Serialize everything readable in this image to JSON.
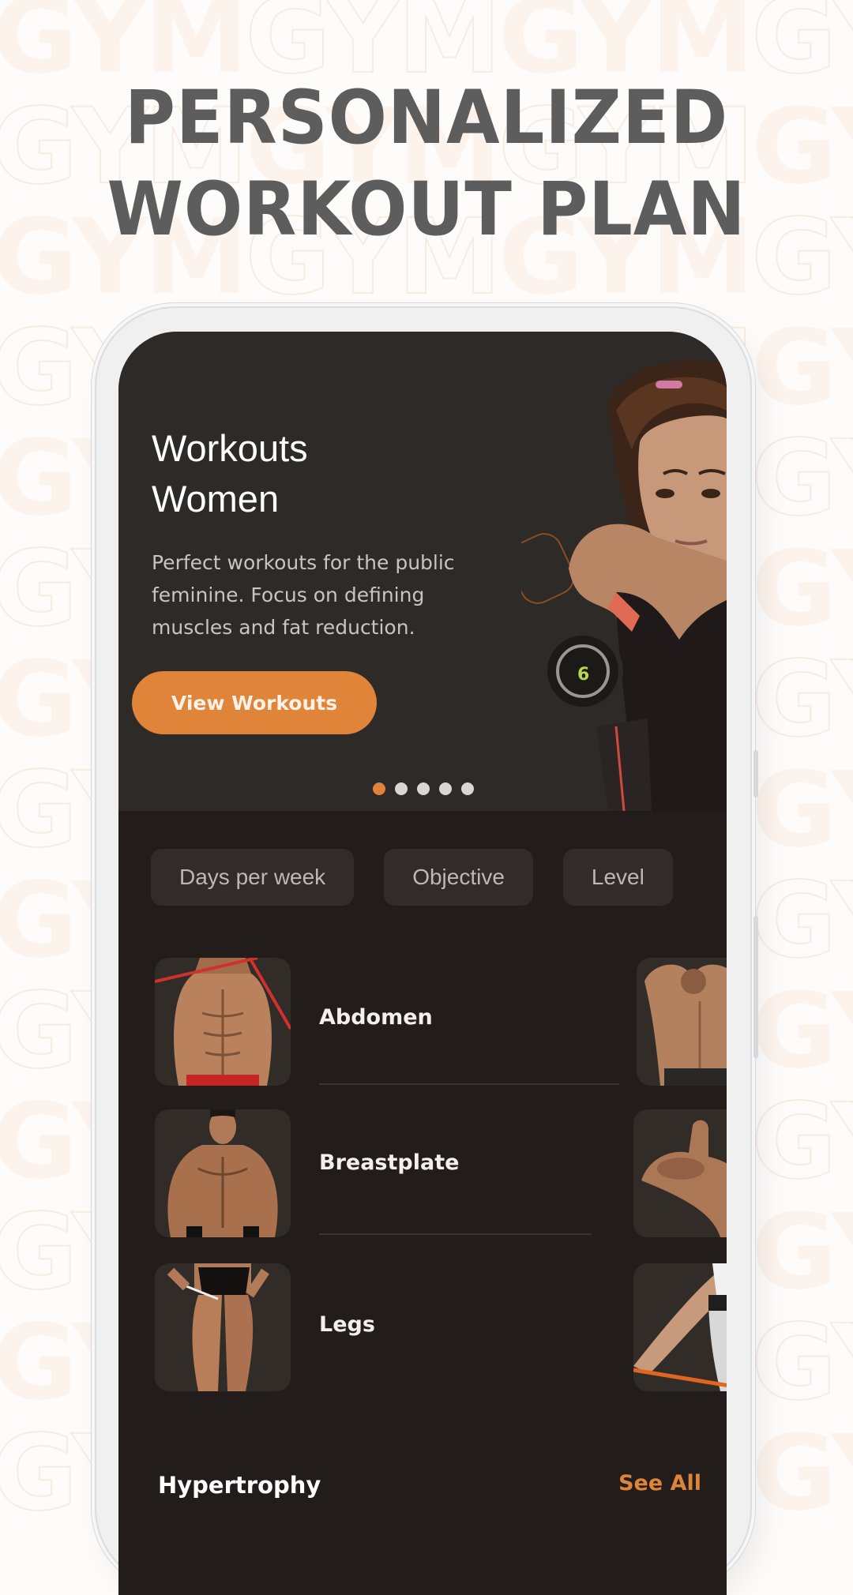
{
  "headline": {
    "line1": "PERSONALIZED",
    "line2": "WORKOUT PLAN"
  },
  "watermark": {
    "word": "GYM"
  },
  "colors": {
    "accent": "#e0843a",
    "hero_bg": "#2e2a27",
    "screen_bg": "#221c1b",
    "chip_bg": "#312b29",
    "headline": "#5d5d5d"
  },
  "hero": {
    "title_line1": "Workouts",
    "title_line2": "Women",
    "description": "Perfect workouts for the public feminine. Focus on defining muscles and fat reduction.",
    "button_label": "View Workouts",
    "image": "woman-dumbbell-photo",
    "carousel": {
      "total": 5,
      "active_index": 0
    }
  },
  "filters": [
    {
      "label": "Days per week"
    },
    {
      "label": "Objective"
    },
    {
      "label": "Level"
    }
  ],
  "categories": [
    {
      "label": "Abdomen",
      "image": "abs-photo",
      "peek_image": "back-photo"
    },
    {
      "label": "Breastplate",
      "image": "chest-photo",
      "peek_image": "biceps-photo"
    },
    {
      "label": "Legs",
      "image": "legs-photo",
      "peek_image": "glutes-band-photo"
    }
  ],
  "section": {
    "title": "Hypertrophy",
    "see_all_label": "See All"
  }
}
